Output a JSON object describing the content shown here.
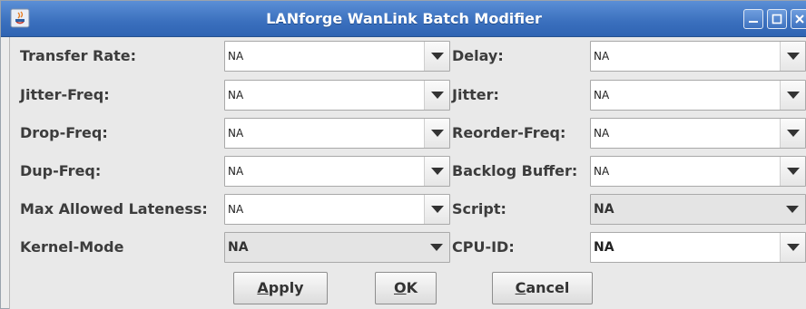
{
  "window": {
    "title": "LANforge WanLink Batch Modifier"
  },
  "icons": {
    "app": "java-app-icon",
    "minimize": "minimize-icon",
    "maximize": "maximize-icon",
    "close": "close-icon",
    "dropdown": "chevron-down-icon"
  },
  "left_fields": [
    {
      "label": "Transfer Rate:",
      "value": "NA"
    },
    {
      "label": "Jitter-Freq:",
      "value": "NA"
    },
    {
      "label": "Drop-Freq:",
      "value": "NA"
    },
    {
      "label": "Dup-Freq:",
      "value": "NA"
    },
    {
      "label": "Max Allowed Lateness:",
      "value": "NA"
    },
    {
      "label": "Kernel-Mode",
      "value": "NA"
    }
  ],
  "right_fields": [
    {
      "label": "Delay:",
      "value": "NA"
    },
    {
      "label": "Jitter:",
      "value": "NA"
    },
    {
      "label": "Reorder-Freq:",
      "value": "NA"
    },
    {
      "label": "Backlog Buffer:",
      "value": "NA"
    },
    {
      "label": "Script:",
      "value": "NA"
    },
    {
      "label": "CPU-ID:",
      "value": "NA"
    }
  ],
  "buttons": {
    "apply": {
      "mnemonic": "A",
      "rest": "pply"
    },
    "ok": {
      "mnemonic": "O",
      "rest": "K"
    },
    "cancel": {
      "mnemonic": "C",
      "rest": "ancel"
    }
  }
}
